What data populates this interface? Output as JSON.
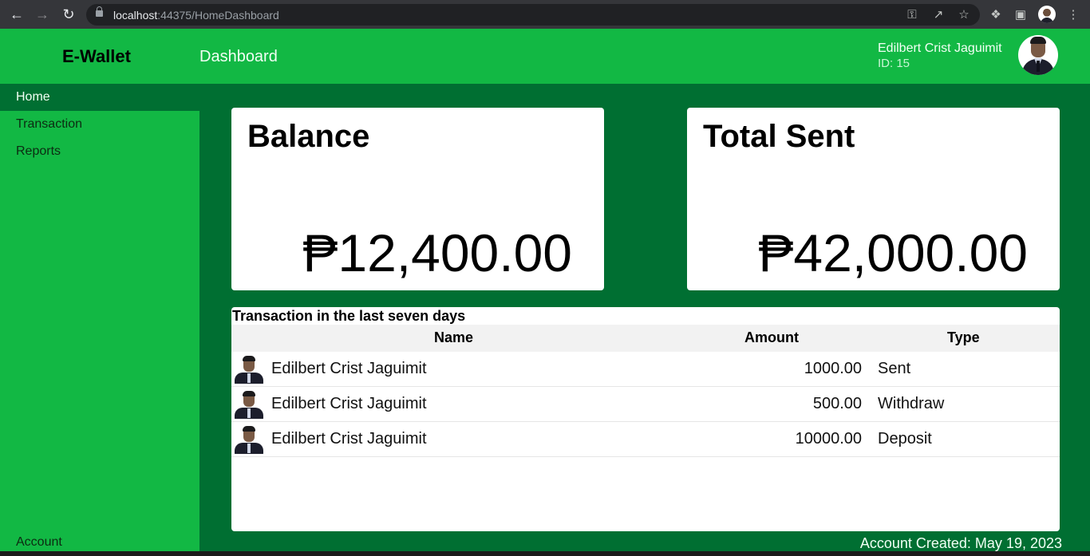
{
  "browser": {
    "url_host": "localhost",
    "url_rest": ":44375/HomeDashboard",
    "icons": [
      "back-arrow-icon",
      "forward-arrow-icon",
      "reload-icon",
      "lock-icon",
      "key-icon",
      "share-icon",
      "star-icon",
      "extensions-icon",
      "side-panel-icon",
      "profile-avatar",
      "menu-dots-icon"
    ]
  },
  "header": {
    "brand": "E-Wallet",
    "page_title": "Dashboard",
    "user_name": "Edilbert Crist Jaguimit",
    "user_id": "ID: 15"
  },
  "sidebar": {
    "items": [
      {
        "label": "Home",
        "active": true
      },
      {
        "label": "Transaction",
        "active": false
      },
      {
        "label": "Reports",
        "active": false
      }
    ],
    "account_label": "Account"
  },
  "cards": {
    "balance": {
      "title": "Balance",
      "value": "₱12,400.00"
    },
    "total_sent": {
      "title": "Total Sent",
      "value": "₱42,000.00"
    }
  },
  "transactions": {
    "title": "Transaction in the last seven days",
    "columns": [
      "Name",
      "Amount",
      "Type"
    ],
    "rows": [
      {
        "name": "Edilbert Crist Jaguimit",
        "amount": "1000.00",
        "type": "Sent"
      },
      {
        "name": "Edilbert Crist Jaguimit",
        "amount": "500.00",
        "type": "Withdraw"
      },
      {
        "name": "Edilbert Crist Jaguimit",
        "amount": "10000.00",
        "type": "Deposit"
      }
    ]
  },
  "footer": {
    "account_created": "Account Created: May 19, 2023"
  },
  "colors": {
    "primary_green": "#12b844",
    "dark_green": "#006f32"
  }
}
